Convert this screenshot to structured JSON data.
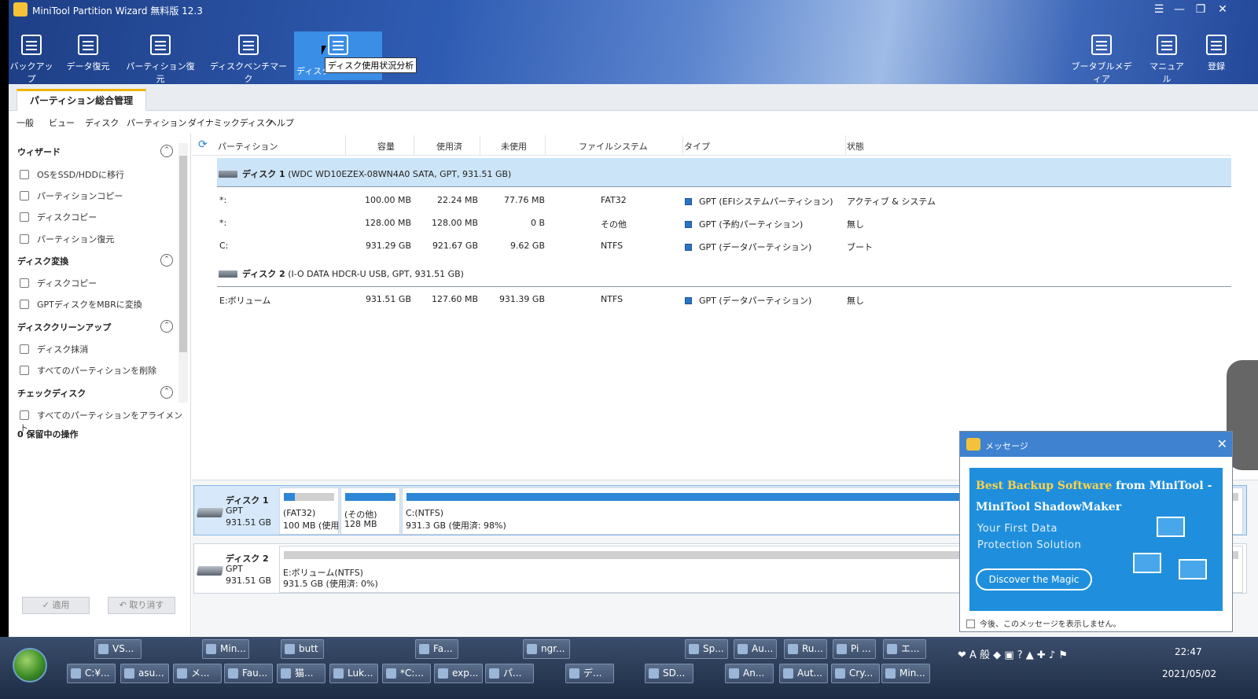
{
  "window": {
    "title": "MiniTool Partition Wizard 無料版 12.3"
  },
  "toolbar": {
    "left": [
      {
        "label": "バックアップ",
        "icon": "backup-icon"
      },
      {
        "label": "データ復元",
        "icon": "data-recovery-icon"
      },
      {
        "label": "パーティション復元",
        "icon": "partition-recovery-icon"
      },
      {
        "label": "ディスクベンチマーク",
        "icon": "disk-benchmark-icon"
      },
      {
        "label": "ディスク使用状況分析",
        "icon": "space-analyzer-icon"
      }
    ],
    "right": [
      {
        "label": "ブータブルメディア",
        "icon": "bootable-media-icon"
      },
      {
        "label": "マニュアル",
        "icon": "manual-icon"
      },
      {
        "label": "登録",
        "icon": "register-icon"
      }
    ],
    "tooltip": "ディスク使用状況分析",
    "partial_label": "ディスク"
  },
  "tab": {
    "label": "パーティション総合管理"
  },
  "menu": [
    "一般",
    "ビュー",
    "ディスク",
    "パーティション",
    "ダイナミックディスク",
    "ヘルプ"
  ],
  "sidebar": {
    "sections": [
      {
        "title": "ウィザード",
        "items": [
          "OSをSSD/HDDに移行",
          "パーティションコピー",
          "ディスクコピー",
          "パーティション復元"
        ]
      },
      {
        "title": "ディスク変換",
        "items": [
          "ディスクコピー",
          "GPTディスクをMBRに変換"
        ]
      },
      {
        "title": "ディスククリーンアップ",
        "items": [
          "ディスク抹消",
          "すべてのパーティションを削除"
        ]
      },
      {
        "title": "チェックディスク",
        "items": [
          "すべてのパーティションをアライメント"
        ]
      }
    ],
    "pending": "0 保留中の操作",
    "apply": "✓ 適用",
    "undo": "↶ 取り消す"
  },
  "table": {
    "headers": [
      "パーティション",
      "容量",
      "使用済",
      "未使用",
      "ファイルシステム",
      "タイプ",
      "状態"
    ],
    "disks": [
      {
        "label": "ディスク 1",
        "detail": "(WDC WD10EZEX-08WN4A0 SATA, GPT, 931.51 GB)",
        "rows": [
          [
            "*:",
            "100.00 MB",
            "22.24 MB",
            "77.76 MB",
            "FAT32",
            "GPT (EFIシステムパーティション)",
            "アクティブ & システム"
          ],
          [
            "*:",
            "128.00 MB",
            "128.00 MB",
            "0 B",
            "その他",
            "GPT (予約パーティション)",
            "無し"
          ],
          [
            "C:",
            "931.29 GB",
            "921.67 GB",
            "9.62 GB",
            "NTFS",
            "GPT (データパーティション)",
            "ブート"
          ]
        ]
      },
      {
        "label": "ディスク 2",
        "detail": "(I-O DATA HDCR-U USB, GPT, 931.51 GB)",
        "rows": [
          [
            "E:ボリューム",
            "931.51 GB",
            "127.60 MB",
            "931.39 GB",
            "NTFS",
            "GPT (データパーティション)",
            "無し"
          ]
        ]
      }
    ]
  },
  "diskmap": [
    {
      "name": "ディスク 1",
      "type": "GPT",
      "size": "931.51 GB",
      "parts": [
        {
          "l1": "(FAT32)",
          "l2": "100 MB (使用",
          "used": 0.22
        },
        {
          "l1": "(その他)",
          "l2": "128 MB",
          "used": 1.0
        },
        {
          "l1": "C:(NTFS)",
          "l2": "931.3 GB (使用済: 98%)",
          "used": 0.98
        }
      ]
    },
    {
      "name": "ディスク 2",
      "type": "GPT",
      "size": "931.51 GB",
      "parts": [
        {
          "l1": "E:ボリューム(NTFS)",
          "l2": "931.5 GB (使用済: 0%)",
          "used": 0.0
        }
      ]
    }
  ],
  "popup": {
    "title": "メッセージ",
    "line1a": "Best Backup Software",
    "line1b": "from MiniTool -",
    "line2": "MiniTool ShadowMaker",
    "line3": "Your First Data",
    "line4": "Protection Solution",
    "button": "Discover the Magic",
    "checkbox": "今後、このメッセージを表示しません。"
  },
  "taskbar": {
    "row1": [
      "VS...",
      "Min...",
      "butt",
      "Fa...",
      "ngr...",
      "Sp...",
      "Au...",
      "Ru...",
      "Pi ...",
      "エ..."
    ],
    "row2": [
      "C:¥...",
      "asu...",
      "メ...",
      "Fau...",
      "猫...",
      "Luk...",
      "*C:...",
      "exp...",
      "パ...",
      "デ...",
      "SD...",
      "An...",
      "Aut...",
      "Cry...",
      "Min..."
    ],
    "time": "22:47",
    "date": "2021/05/02"
  }
}
